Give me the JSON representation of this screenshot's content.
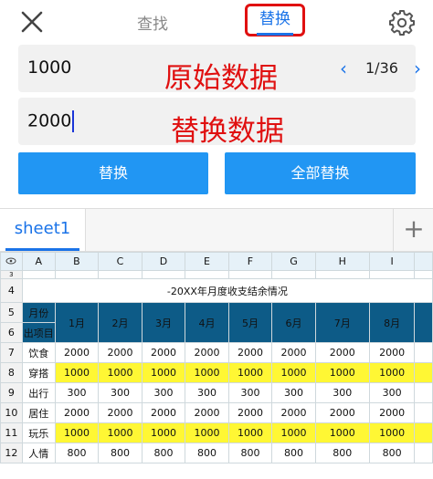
{
  "header": {
    "tab_find": "查找",
    "tab_replace": "替换",
    "accent_color": "#1a73e8",
    "highlight_color": "#e01010",
    "icons": [
      "close-icon",
      "gear-icon"
    ]
  },
  "search": {
    "find_value": "1000",
    "replace_value": "2000",
    "find_annotation": "原始数据",
    "replace_annotation": "替换数据",
    "match_position": "1/36",
    "prev_icon": "‹",
    "next_icon": "›"
  },
  "buttons": {
    "replace": "替换",
    "replace_all": "全部替换",
    "color": "#2196f3"
  },
  "sheet_tabs": {
    "active": "sheet1",
    "add": "+"
  },
  "spreadsheet": {
    "eye_icon": "eye-icon",
    "column_letters": [
      "A",
      "B",
      "C",
      "D",
      "E",
      "F",
      "G",
      "H",
      "I"
    ],
    "title_row_number": "4",
    "top_row_number": "3",
    "title": "-20XX年月度收支结余情况",
    "header_rows": [
      "5",
      "6"
    ],
    "header_month_label": "月份",
    "header_item_label": "出项目",
    "months": [
      "1月",
      "2月",
      "3月",
      "4月",
      "5月",
      "6月",
      "7月",
      "8月"
    ],
    "rows": [
      {
        "num": "7",
        "label": "饮食",
        "values": [
          "2000",
          "2000",
          "2000",
          "2000",
          "2000",
          "2000",
          "2000",
          "2000"
        ],
        "highlight": false
      },
      {
        "num": "8",
        "label": "穿搭",
        "values": [
          "1000",
          "1000",
          "1000",
          "1000",
          "1000",
          "1000",
          "1000",
          "1000"
        ],
        "highlight": true
      },
      {
        "num": "9",
        "label": "出行",
        "values": [
          "300",
          "300",
          "300",
          "300",
          "300",
          "300",
          "300",
          "300"
        ],
        "highlight": false
      },
      {
        "num": "10",
        "label": "居住",
        "values": [
          "2000",
          "2000",
          "2000",
          "2000",
          "2000",
          "2000",
          "2000",
          "2000"
        ],
        "highlight": false
      },
      {
        "num": "11",
        "label": "玩乐",
        "values": [
          "1000",
          "1000",
          "1000",
          "1000",
          "1000",
          "1000",
          "1000",
          "1000"
        ],
        "highlight": true
      },
      {
        "num": "12",
        "label": "人情",
        "values": [
          "800",
          "800",
          "800",
          "800",
          "800",
          "800",
          "800",
          "800"
        ],
        "highlight": false
      }
    ]
  }
}
